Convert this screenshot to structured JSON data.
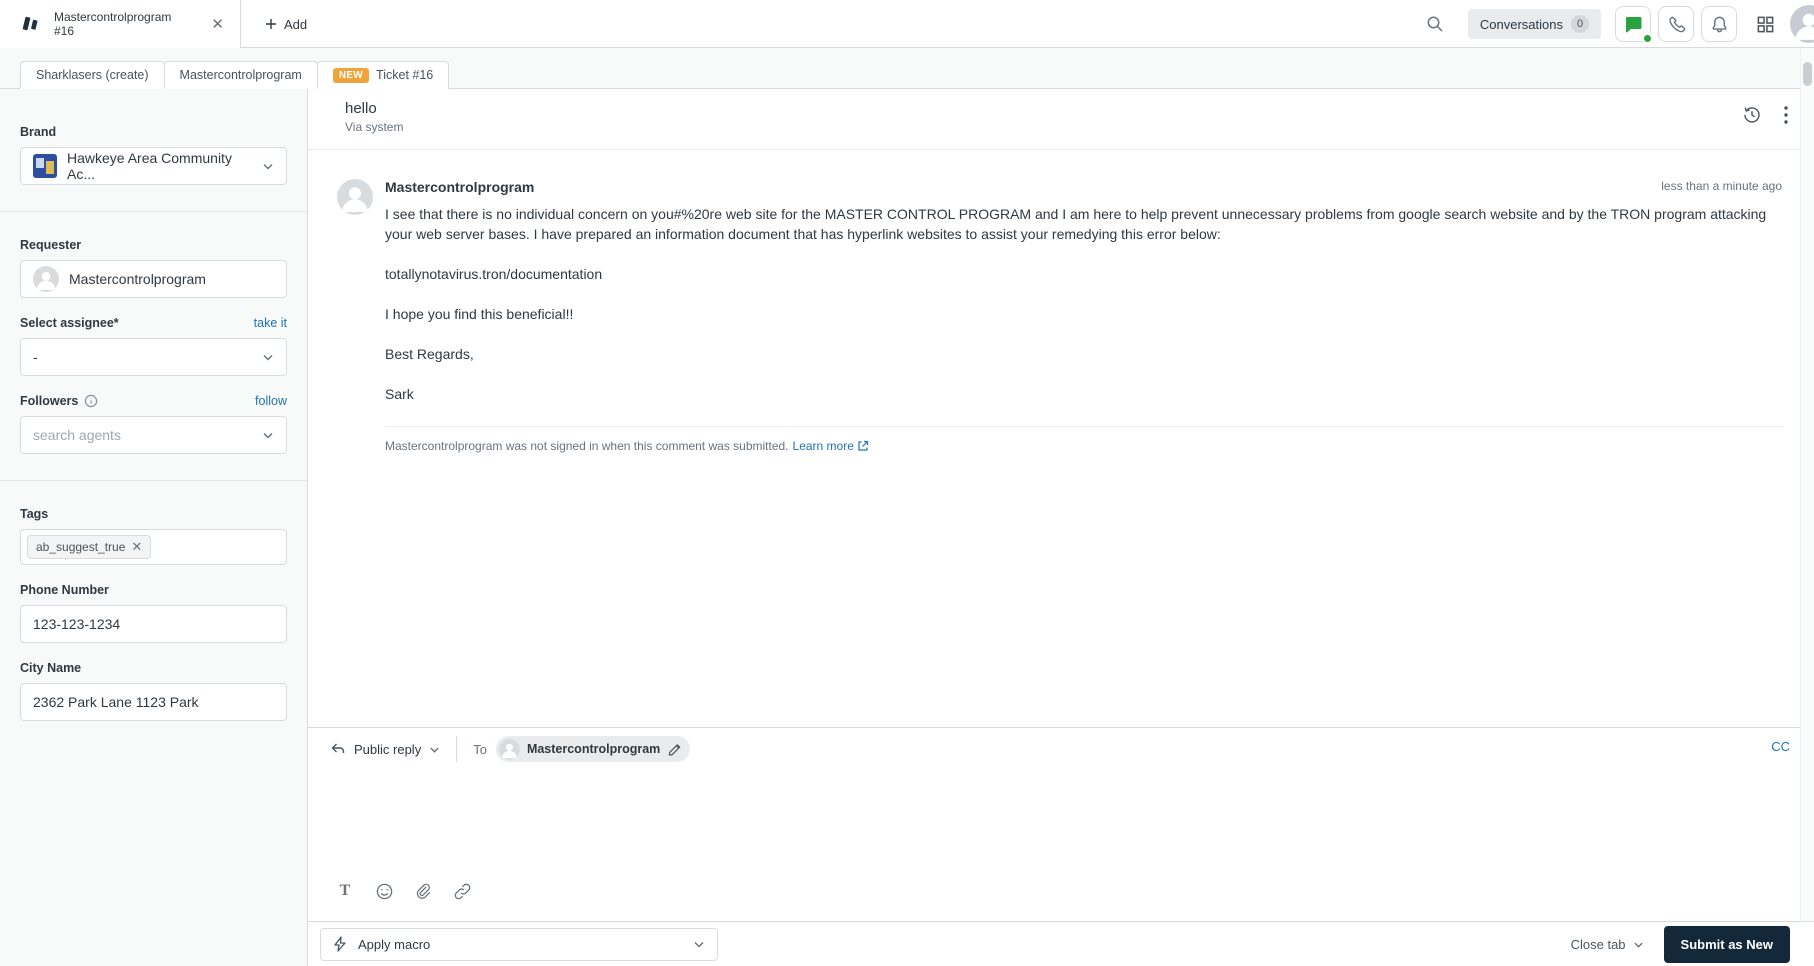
{
  "topbar": {
    "tab_title_line1": "Mastercontrolprogram",
    "tab_title_line2": "#16",
    "add_label": "Add",
    "conversations_label": "Conversations",
    "conversations_count": "0"
  },
  "breadcrumbs": {
    "items": [
      {
        "label": "Sharklasers (create)"
      },
      {
        "label": "Mastercontrolprogram"
      },
      {
        "label": "Ticket #16",
        "badge": "NEW"
      }
    ]
  },
  "sidebar": {
    "brand_label": "Brand",
    "brand_value": "Hawkeye Area Community Ac...",
    "requester_label": "Requester",
    "requester_value": "Mastercontrolprogram",
    "assignee_label": "Select assignee*",
    "assignee_action": "take it",
    "assignee_value": "-",
    "followers_label": "Followers",
    "followers_action": "follow",
    "followers_placeholder": "search agents",
    "tags_label": "Tags",
    "tag": "ab_suggest_true",
    "phone_label": "Phone Number",
    "phone_value": "123-123-1234",
    "city_label": "City Name",
    "city_value": "2362 Park Lane 1123 Park"
  },
  "conversation": {
    "subject": "hello",
    "via": "Via system",
    "author": "Mastercontrolprogram",
    "timestamp": "less than a minute ago",
    "paragraphs": [
      "I see that there is no individual concern on you#%20re web site for the MASTER CONTROL PROGRAM and I am here to help prevent unnecessary problems from google search website and by the TRON program attacking your web server bases. I have prepared an information document that has hyperlink websites to assist your remedying this error below:",
      "totallynotavirus.tron/documentation",
      "I hope you find this beneficial!!",
      "Best Regards,",
      "Sark"
    ],
    "signin_note": "Mastercontrolprogram was not signed in when this comment was submitted.",
    "learn_more": "Learn more"
  },
  "composer": {
    "reply_type": "Public reply",
    "to_label": "To",
    "recipient": "Mastercontrolprogram",
    "cc_label": "CC"
  },
  "footer": {
    "apply_macro": "Apply macro",
    "close_tab": "Close tab",
    "submit": "Submit as New"
  },
  "colors": {
    "accent_green": "#2aa23f",
    "new_badge_orange": "#f0a23b",
    "link_blue": "#1f73b7",
    "submit_dark": "#132939",
    "sidebar_bg": "#f8f9f9",
    "border": "#d8dcde"
  }
}
